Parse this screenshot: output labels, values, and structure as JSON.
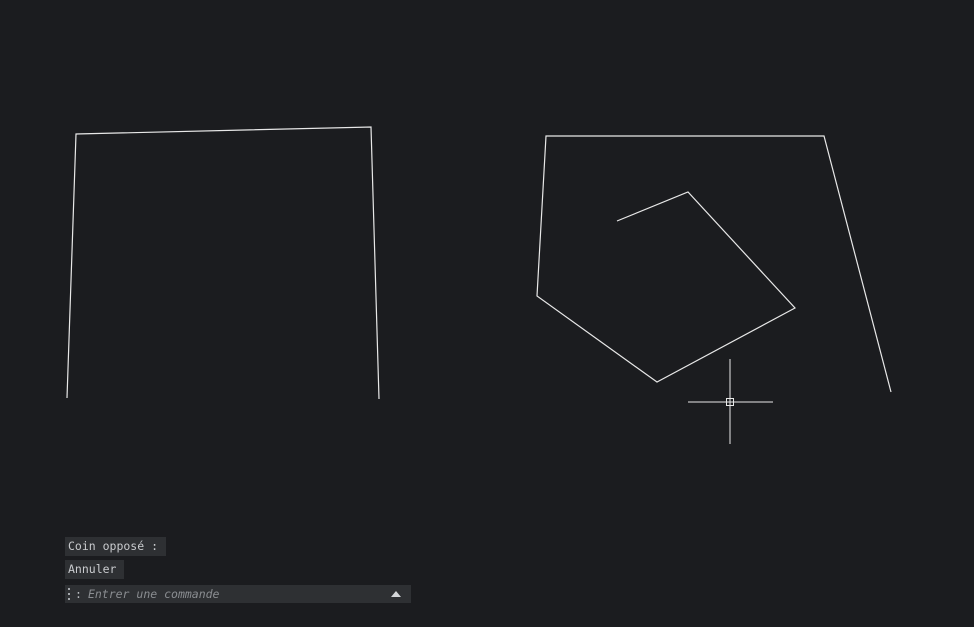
{
  "command_line": {
    "history": [
      "Coin opposé :",
      "Annuler"
    ],
    "prompt_symbol": ":",
    "input_value": "",
    "input_placeholder": "Entrer une commande",
    "history_toggle_icon": "caret-up-icon"
  },
  "cursor": {
    "icon": "crosshair-cursor-icon"
  },
  "colors": {
    "background": "#1b1c1f",
    "geometry": "#ffffff",
    "command_bar": "#2e3033"
  }
}
